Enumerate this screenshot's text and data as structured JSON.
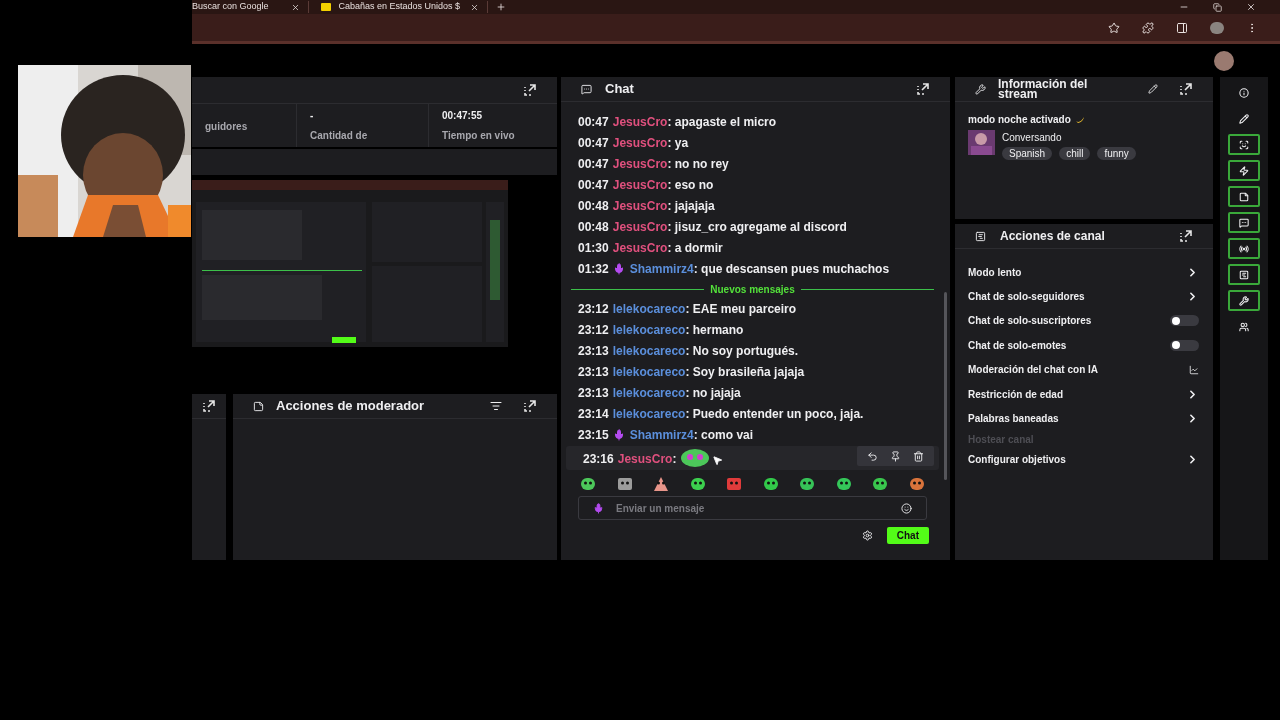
{
  "browser": {
    "tabs": [
      {
        "title": "Buscar con Google"
      },
      {
        "title": "Cabañas en Estados Unidos $"
      }
    ]
  },
  "stats": {
    "items": [
      {
        "label": "guidores"
      },
      {
        "value": "-",
        "label": "Cantidad de"
      },
      {
        "value": "00:47:55",
        "label": "Tiempo en vivo"
      }
    ]
  },
  "moderator_actions": {
    "title": "Acciones de moderador"
  },
  "chat": {
    "title": "Chat",
    "divider": "Nuevos mensajes",
    "messages": [
      {
        "time": "00:47",
        "user": "JesusCro",
        "color": "#e0507e",
        "badge": false,
        "kind": "text",
        "text": ": apagaste el micro",
        "hovered": false
      },
      {
        "time": "00:47",
        "user": "JesusCro",
        "color": "#e0507e",
        "badge": false,
        "kind": "text",
        "text": ": ya",
        "hovered": false
      },
      {
        "time": "00:47",
        "user": "JesusCro",
        "color": "#e0507e",
        "badge": false,
        "kind": "text",
        "text": ": no no rey",
        "hovered": false
      },
      {
        "time": "00:47",
        "user": "JesusCro",
        "color": "#e0507e",
        "badge": false,
        "kind": "text",
        "text": ": eso no",
        "hovered": false
      },
      {
        "time": "00:48",
        "user": "JesusCro",
        "color": "#e0507e",
        "badge": false,
        "kind": "text",
        "text": ": jajajaja",
        "hovered": false
      },
      {
        "time": "00:48",
        "user": "JesusCro",
        "color": "#e0507e",
        "badge": false,
        "kind": "text",
        "text": ": jisuz_cro agregame al discord",
        "hovered": false
      },
      {
        "time": "01:30",
        "user": "JesusCro",
        "color": "#e0507e",
        "badge": false,
        "kind": "text",
        "text": ": a dormir",
        "hovered": false
      },
      {
        "time": "01:32",
        "user": "Shammirz4",
        "color": "#5b8fdc",
        "badge": true,
        "kind": "text",
        "text": ": que descansen pues muchachos",
        "hovered": false
      },
      {
        "time": "23:12",
        "user": "lelekocareco",
        "color": "#5b8fdc",
        "badge": false,
        "kind": "text",
        "text": ": EAE meu parceiro",
        "hovered": false,
        "new": true
      },
      {
        "time": "23:12",
        "user": "lelekocareco",
        "color": "#5b8fdc",
        "badge": false,
        "kind": "text",
        "text": ": hermano",
        "hovered": false
      },
      {
        "time": "23:13",
        "user": "lelekocareco",
        "color": "#5b8fdc",
        "badge": false,
        "kind": "text",
        "text": ": No soy portugués.",
        "hovered": false
      },
      {
        "time": "23:13",
        "user": "lelekocareco",
        "color": "#5b8fdc",
        "badge": false,
        "kind": "text",
        "text": ": Soy brasileña jajaja",
        "hovered": false
      },
      {
        "time": "23:13",
        "user": "lelekocareco",
        "color": "#5b8fdc",
        "badge": false,
        "kind": "text",
        "text": ": no jajaja",
        "hovered": false
      },
      {
        "time": "23:14",
        "user": "lelekocareco",
        "color": "#5b8fdc",
        "badge": false,
        "kind": "text",
        "text": ": Puedo entender un poco, jaja.",
        "hovered": false
      },
      {
        "time": "23:15",
        "user": "Shammirz4",
        "color": "#5b8fdc",
        "badge": true,
        "kind": "text",
        "text": ": como vai",
        "hovered": false
      },
      {
        "time": "23:16",
        "user": "JesusCro",
        "color": "#e0507e",
        "badge": false,
        "kind": "emote",
        "text": ":",
        "hovered": true
      }
    ],
    "input": {
      "placeholder": "Enviar un mensaje"
    },
    "send_button": "Chat"
  },
  "stream_info": {
    "title": "Información del stream",
    "status": "modo noche activado",
    "category": "Conversando",
    "tags": [
      "Spanish",
      "chill",
      "funny"
    ]
  },
  "channel_actions": {
    "title": "Acciones de canal",
    "items": [
      {
        "label": "Modo lento",
        "kind": "arrow",
        "disabled": false
      },
      {
        "label": "Chat de solo-seguidores",
        "kind": "arrow",
        "disabled": false
      },
      {
        "label": "Chat de solo-suscriptores",
        "kind": "toggle",
        "on": false,
        "disabled": false
      },
      {
        "label": "Chat de solo-emotes",
        "kind": "toggle",
        "on": false,
        "disabled": false
      },
      {
        "label": "Moderación del chat con IA",
        "kind": "external",
        "disabled": false
      },
      {
        "label": "Restricción de edad",
        "kind": "arrow",
        "disabled": false
      },
      {
        "label": "Palabras baneadas",
        "kind": "arrow",
        "disabled": false
      },
      {
        "label": "Hostear canal",
        "kind": "plain",
        "disabled": true
      },
      {
        "label": "Configurar objetivos",
        "kind": "arrow",
        "disabled": false
      }
    ]
  },
  "side_tools": [
    {
      "active": false
    },
    {
      "active": false
    },
    {
      "active": true
    },
    {
      "active": true
    },
    {
      "active": true
    },
    {
      "active": true
    },
    {
      "active": true
    },
    {
      "active": true
    },
    {
      "active": true
    },
    {
      "active": false
    }
  ]
}
